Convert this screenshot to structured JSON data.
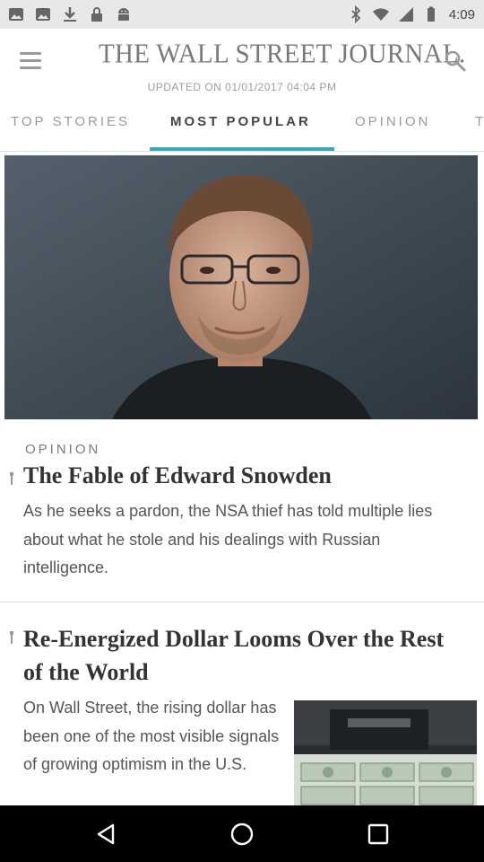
{
  "status_bar": {
    "time": "4:09",
    "left_icons": [
      "gallery-icon",
      "gallery-icon",
      "download-icon",
      "lock-icon",
      "android-icon"
    ],
    "right_icons": [
      "bluetooth-icon",
      "wifi-icon",
      "signal-icon",
      "battery-icon"
    ]
  },
  "header": {
    "masthead": "THE WALL STREET JOURNAL.",
    "updated": "UPDATED ON 01/01/2017 04:04 PM"
  },
  "tabs": [
    {
      "label": "TOP STORIES",
      "active": false
    },
    {
      "label": "MOST POPULAR",
      "active": true
    },
    {
      "label": "OPINION",
      "active": false
    },
    {
      "label": "T",
      "active": false
    }
  ],
  "articles": [
    {
      "section": "OPINION",
      "headline": "The Fable of Edward Snowden",
      "summary": "As he seeks a pardon, the NSA thief has told multiple lies about what he stole and his dealings with Russian intelligence."
    },
    {
      "headline": "Re-Energized Dollar Looms Over the Rest of the World",
      "summary": "On Wall Street, the rising dollar has been one of the most visible signals of growing optimism in the U.S."
    }
  ],
  "colors": {
    "accent": "#3aa8b9",
    "status_bar_bg": "#e8e8e8",
    "nav_bar_bg": "#000000"
  },
  "nav_bar": {
    "buttons": [
      "back-icon",
      "home-icon",
      "recents-icon"
    ]
  }
}
